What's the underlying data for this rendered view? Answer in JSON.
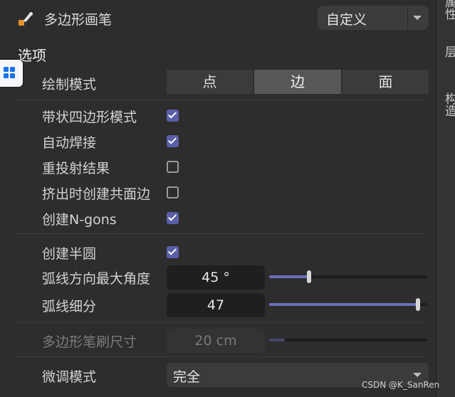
{
  "header": {
    "tool_title": "多边形画笔",
    "preset_value": "自定义"
  },
  "sidebar": {
    "tabs": [
      "属性",
      "层",
      "构造"
    ]
  },
  "section": {
    "title": "选项"
  },
  "draw_mode": {
    "label": "绘制模式",
    "options": [
      "点",
      "边",
      "面"
    ],
    "selected": "边"
  },
  "checkboxes": [
    {
      "label": "带状四边形模式",
      "checked": true
    },
    {
      "label": "自动焊接",
      "checked": true
    },
    {
      "label": "重投射结果",
      "checked": false
    },
    {
      "label": "挤出时创建共面边",
      "checked": false
    },
    {
      "label": "创建N-gons",
      "checked": true
    }
  ],
  "semicircle": {
    "label": "创建半圆",
    "checked": true
  },
  "arc_angle": {
    "label": "弧线方向最大角度",
    "value": "45 °",
    "slider_fraction": 0.25
  },
  "arc_subdiv": {
    "label": "弧线细分",
    "value": "47",
    "slider_fraction": 0.94
  },
  "brush_size": {
    "label": "多边形笔刷尺寸",
    "value": "20 cm",
    "slider_fraction": 0.1,
    "disabled": true
  },
  "tweak_mode": {
    "label": "微调模式",
    "value": "完全"
  },
  "watermark": "CSDN @K_SanRen",
  "colors": {
    "accent": "#5a5fa8",
    "panel_bg": "#2d2d2d",
    "tool_icon": "#e8912c"
  }
}
